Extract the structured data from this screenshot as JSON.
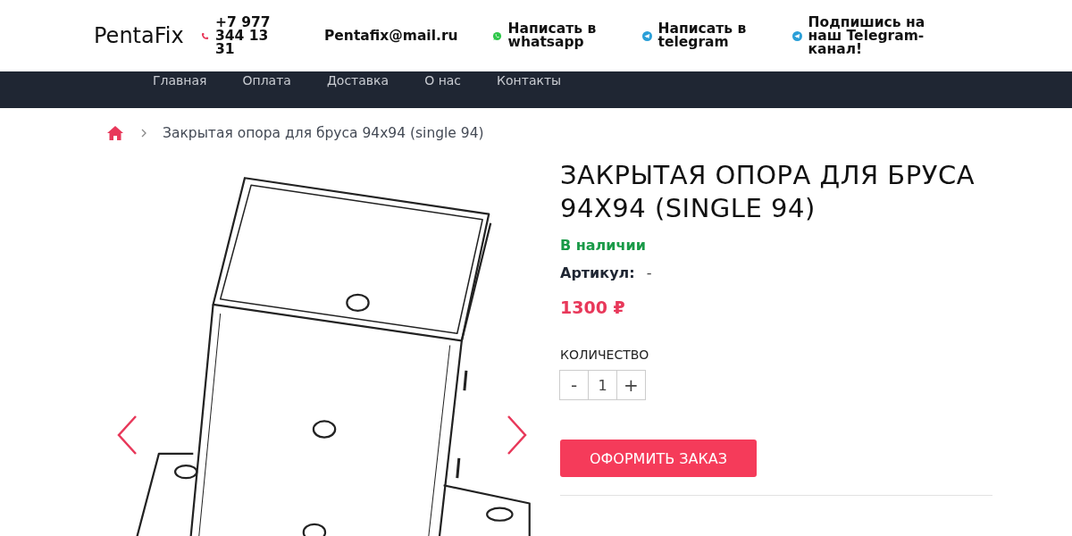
{
  "header": {
    "logo": "PentaFix",
    "phone": "+7 977 344 13 31",
    "email": "Pentafix@mail.ru",
    "links": [
      {
        "kind": "whatsapp",
        "label": "Написать в whatsapp"
      },
      {
        "kind": "telegram",
        "label": "Написать в telegram"
      },
      {
        "kind": "telegram",
        "label": "Подпишись на наш Telegram-канал!"
      }
    ]
  },
  "nav": [
    "Главная",
    "Оплата",
    "Доставка",
    "О нас",
    "Контакты"
  ],
  "breadcrumb": {
    "current": "Закрытая опора для бруса 94х94 (single 94)"
  },
  "product": {
    "title": "ЗАКРЫТАЯ ОПОРА ДЛЯ БРУСА 94Х94 (SINGLE 94)",
    "availability": "В наличии",
    "sku_label": "Артикул:",
    "sku_value": "-",
    "price": "1300 ₽",
    "quantity_label": "КОЛИЧЕСТВО",
    "minus": "-",
    "quantity": "1",
    "plus": "+",
    "order_button": "ОФОРМИТЬ ЗАКАЗ"
  }
}
